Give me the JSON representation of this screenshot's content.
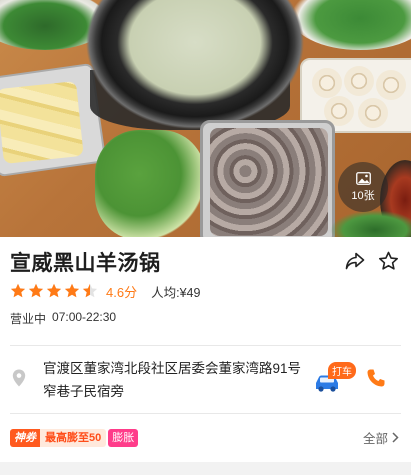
{
  "hero": {
    "photo_count": "10张",
    "photo_icon": "picture-icon"
  },
  "shop": {
    "name": "宣威黑山羊汤锅",
    "share_icon": "share-icon",
    "favorite_icon": "star-outline-icon"
  },
  "rating": {
    "stars": 4.5,
    "score_text": "4.6分",
    "per_capita_label": "人均:",
    "per_capita_value": "¥49"
  },
  "hours": {
    "status": "营业中",
    "time": "07:00-22:30"
  },
  "address": {
    "text": "官渡区董家湾北段社区居委会董家湾路91号窄巷子民宿旁",
    "pin_icon": "location-pin-icon",
    "taxi_label": "打车",
    "car_icon": "car-icon",
    "phone_icon": "phone-icon"
  },
  "promo": {
    "tag": "神券",
    "text": "最高膨至50",
    "suffix": "膨胀",
    "all_label": "全部",
    "chevron_icon": "chevron-right-icon"
  },
  "colors": {
    "accent": "#ff7a16",
    "star": "#ff7a16",
    "promo": "#ff5a1f",
    "promo_pink": "#ff3c8a"
  }
}
